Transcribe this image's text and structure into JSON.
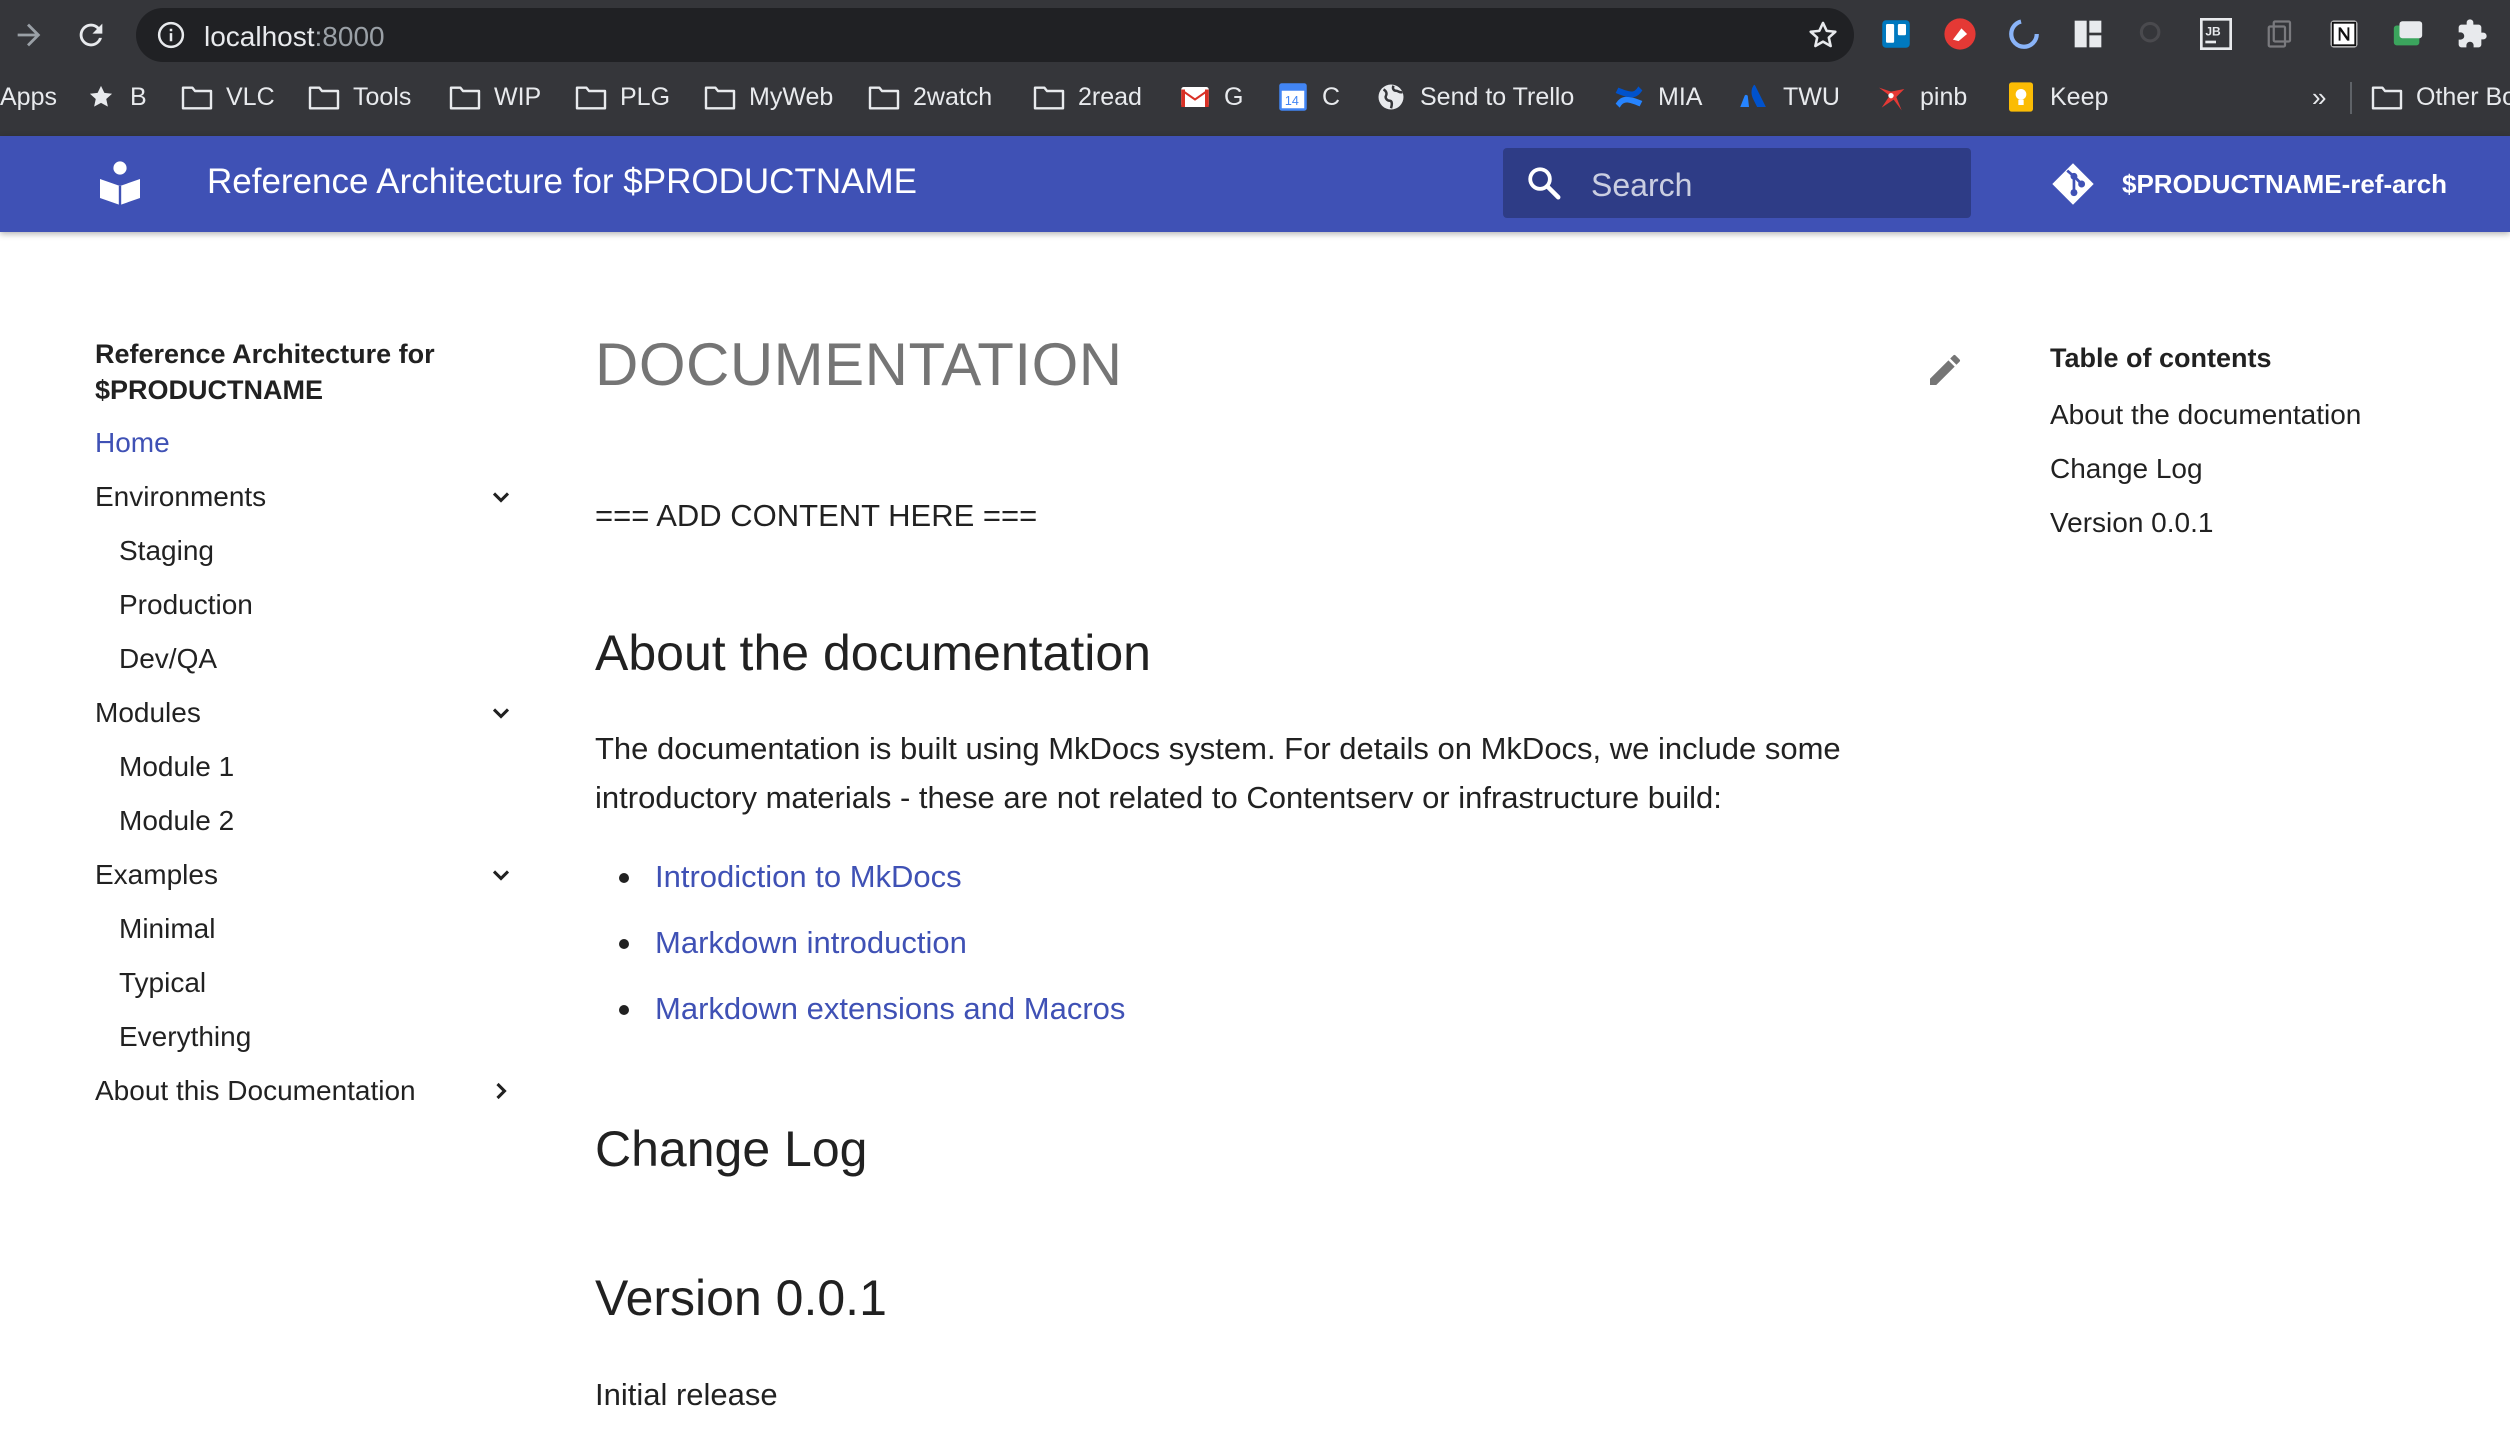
{
  "browser": {
    "url_host": "localhost",
    "url_port": ":8000",
    "bookmarks": [
      {
        "label": "Apps",
        "icon": "apps-grid-icon"
      },
      {
        "label": "B",
        "icon": "star-icon"
      },
      {
        "label": "VLC",
        "icon": "folder-icon"
      },
      {
        "label": "Tools",
        "icon": "folder-icon"
      },
      {
        "label": "WIP",
        "icon": "folder-icon"
      },
      {
        "label": "PLG",
        "icon": "folder-icon"
      },
      {
        "label": "MyWeb",
        "icon": "folder-icon"
      },
      {
        "label": "2watch",
        "icon": "folder-icon"
      },
      {
        "label": "2read",
        "icon": "folder-icon"
      },
      {
        "label": "G",
        "icon": "gmail-icon"
      },
      {
        "label": "C",
        "icon": "calendar-icon",
        "badge": "14"
      },
      {
        "label": "Send to Trello",
        "icon": "globe-icon"
      },
      {
        "label": "MIA",
        "icon": "confluence-icon"
      },
      {
        "label": "TWU",
        "icon": "atlassian-icon"
      },
      {
        "label": "pinb",
        "icon": "pinboard-icon"
      },
      {
        "label": "Keep",
        "icon": "keep-icon"
      }
    ],
    "overflow_label": "»",
    "other_bookmarks": "Other Bo"
  },
  "header": {
    "title": "Reference Architecture for $PRODUCTNAME",
    "search_placeholder": "Search",
    "repo_name": "$PRODUCTNAME-ref-arch"
  },
  "sidebar": {
    "site_title": "Reference Architecture for $PRODUCTNAME",
    "items": [
      {
        "label": "Home",
        "active": true
      },
      {
        "label": "Environments",
        "expandable": true,
        "children": [
          "Staging",
          "Production",
          "Dev/QA"
        ]
      },
      {
        "label": "Modules",
        "expandable": true,
        "children": [
          "Module 1",
          "Module 2"
        ]
      },
      {
        "label": "Examples",
        "expandable": true,
        "children": [
          "Minimal",
          "Typical",
          "Everything"
        ]
      },
      {
        "label": "About this Documentation",
        "collapsed": true
      }
    ]
  },
  "main": {
    "title": "DOCUMENTATION",
    "placeholder_text": "=== ADD CONTENT HERE ===",
    "section_about": "About the documentation",
    "about_text": "The documentation is built using MkDocs system. For details on MkDocs, we include some introductory materials - these are not related to Contentserv or infrastructure build:",
    "links": [
      "Introdiction to MkDocs",
      "Markdown introduction",
      "Markdown extensions and Macros"
    ],
    "section_changelog": "Change Log",
    "section_version": "Version 0.0.1",
    "version_text": "Initial release"
  },
  "toc": {
    "title": "Table of contents",
    "items": [
      "About the documentation",
      "Change Log",
      "Version 0.0.1"
    ]
  },
  "colors": {
    "primary": "#3f51b5",
    "chrome_bg": "#35363a",
    "omnibox_bg": "#202124"
  }
}
